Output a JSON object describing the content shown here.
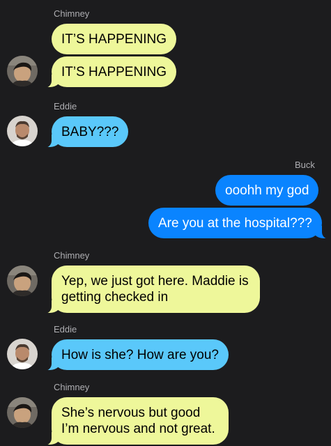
{
  "thread": {
    "name_1": "Chimney",
    "msg_1": "IT’S HAPPENING",
    "msg_2": "IT’S HAPPENING",
    "name_2": "Eddie",
    "msg_3": "BABY???",
    "name_3": "Buck",
    "msg_4": "ooohh my god",
    "msg_5": "Are you at the hospital???",
    "name_4": "Chimney",
    "msg_6_line_1": "Yep, we just got here. Maddie is",
    "msg_6_line_2": "getting checked in",
    "name_5": "Eddie",
    "msg_7": "How is she? How are you?",
    "name_6": "Chimney",
    "msg_8_line_1": "She’s nervous but good",
    "msg_8_line_2": "I’m nervous and not great."
  },
  "colors": {
    "background": "#1c1c1e",
    "chimney_bubble": "#eef79a",
    "eddie_bubble": "#5ac8fa",
    "buck_bubble": "#0a84ff",
    "sender_name": "#aeaeb2"
  },
  "avatars": {
    "chimney": "chimney-avatar",
    "eddie": "eddie-avatar"
  }
}
